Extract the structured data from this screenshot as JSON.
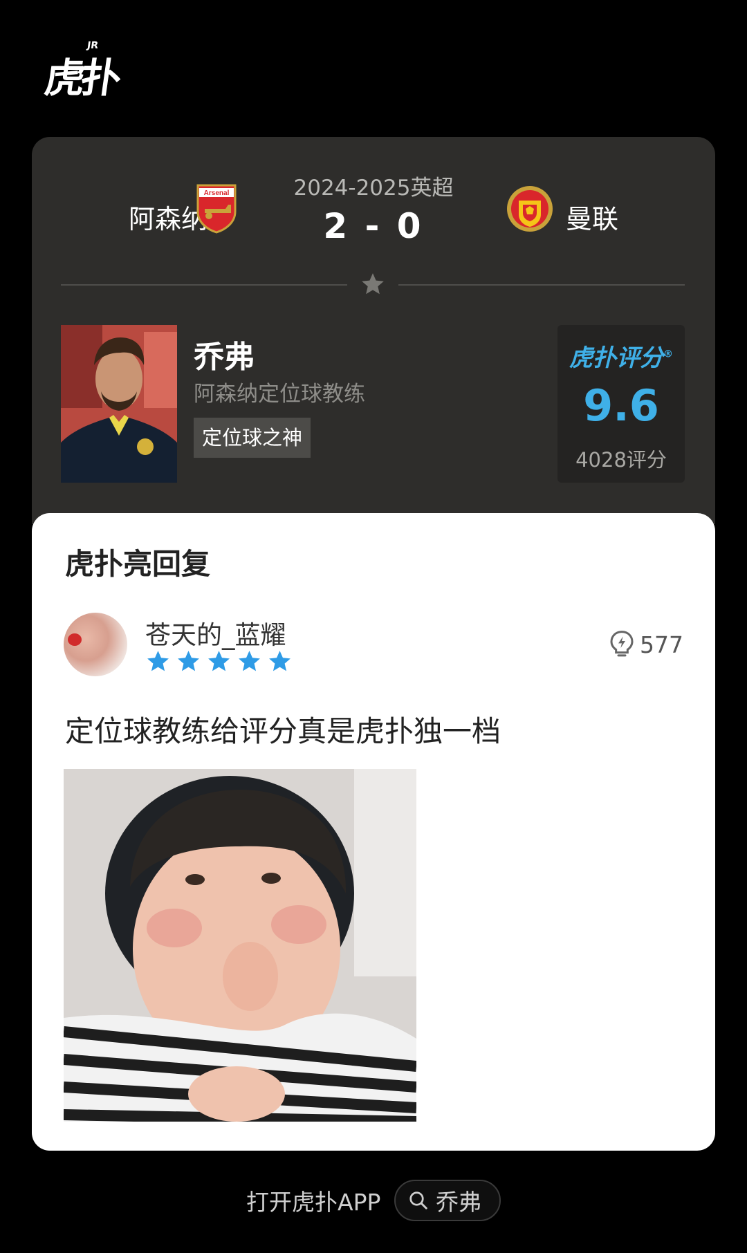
{
  "app": {
    "logo_text": "虎扑",
    "logo_mark": "JR"
  },
  "match": {
    "season": "2024-2025英超",
    "home_team": "阿森纳",
    "away_team": "曼联",
    "score": "2 - 0",
    "home_crest_icon": "arsenal-crest-icon",
    "home_crest_text": "Arsenal",
    "away_crest_icon": "manchester-united-crest-icon"
  },
  "person": {
    "name": "乔弗",
    "role": "阿森纳定位球教练",
    "tag": "定位球之神"
  },
  "rating": {
    "brand": "虎扑评分",
    "score": "9.6",
    "count": "4028评分",
    "accent_color": "#3fb0e8"
  },
  "reply": {
    "section_title": "虎扑亮回复",
    "user_name": "苍天的_蓝耀",
    "stars": 5,
    "star_color": "#2e9be6",
    "likes": "577",
    "text": "定位球教练给评分真是虎扑独一档"
  },
  "footer": {
    "open_app_label": "打开虎扑APP",
    "search_text": "乔弗"
  }
}
